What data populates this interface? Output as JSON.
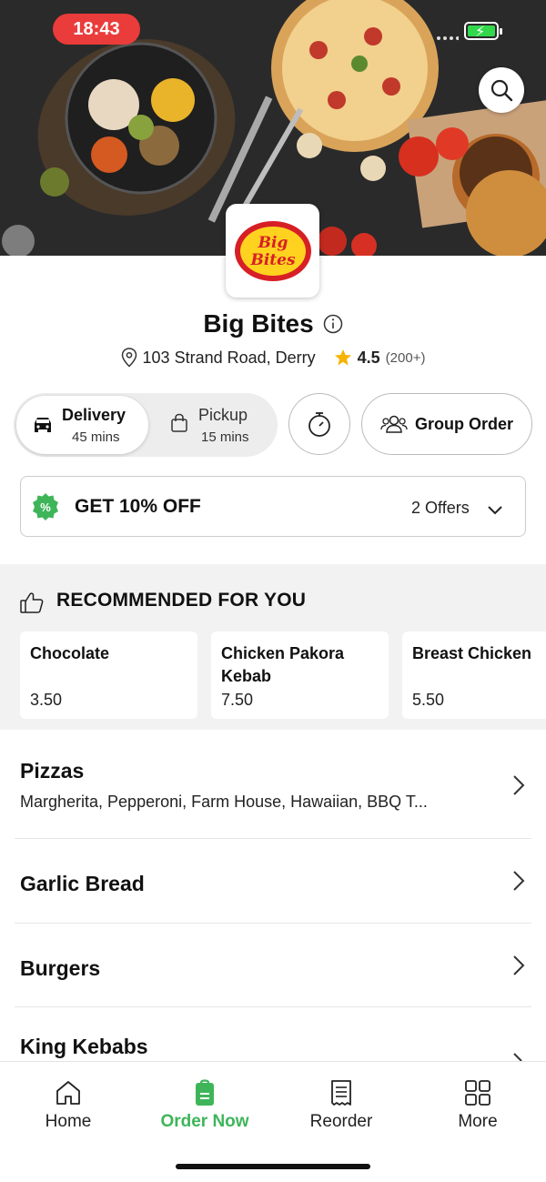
{
  "status_bar": {
    "time": "18:43"
  },
  "store": {
    "name": "Big Bites",
    "address": "103 Strand Road, Derry",
    "rating": "4.5",
    "rating_count": "(200+)",
    "logo_text": "Big Bites"
  },
  "order_modes": {
    "delivery": {
      "label": "Delivery",
      "time": "45 mins"
    },
    "pickup": {
      "label": "Pickup",
      "time": "15 mins"
    },
    "group_order_label": "Group Order"
  },
  "offer": {
    "text": "GET 10% OFF",
    "count_label": "2 Offers",
    "badge_symbol": "%"
  },
  "recommended": {
    "title": "RECOMMENDED FOR YOU",
    "items": [
      {
        "name": "Chocolate",
        "price": "3.50"
      },
      {
        "name": "Chicken Pakora Kebab",
        "price": "7.50"
      },
      {
        "name": "Breast Chicken",
        "price": "5.50"
      }
    ]
  },
  "categories": [
    {
      "title": "Pizzas",
      "subtitle": "Margherita, Pepperoni, Farm House, Hawaiian, BBQ T..."
    },
    {
      "title": "Garlic Bread"
    },
    {
      "title": "Burgers"
    },
    {
      "title": "King Kebabs"
    }
  ],
  "tabs": [
    {
      "label": "Home",
      "icon": "home-icon"
    },
    {
      "label": "Order Now",
      "icon": "order-bag-icon"
    },
    {
      "label": "Reorder",
      "icon": "receipt-icon"
    },
    {
      "label": "More",
      "icon": "grid-icon"
    }
  ],
  "colors": {
    "accent": "#3fb55a",
    "time_pill": "#ea3c3a",
    "star": "#f5b301",
    "logo_red": "#d71f26",
    "logo_yellow": "#ffd21f"
  }
}
